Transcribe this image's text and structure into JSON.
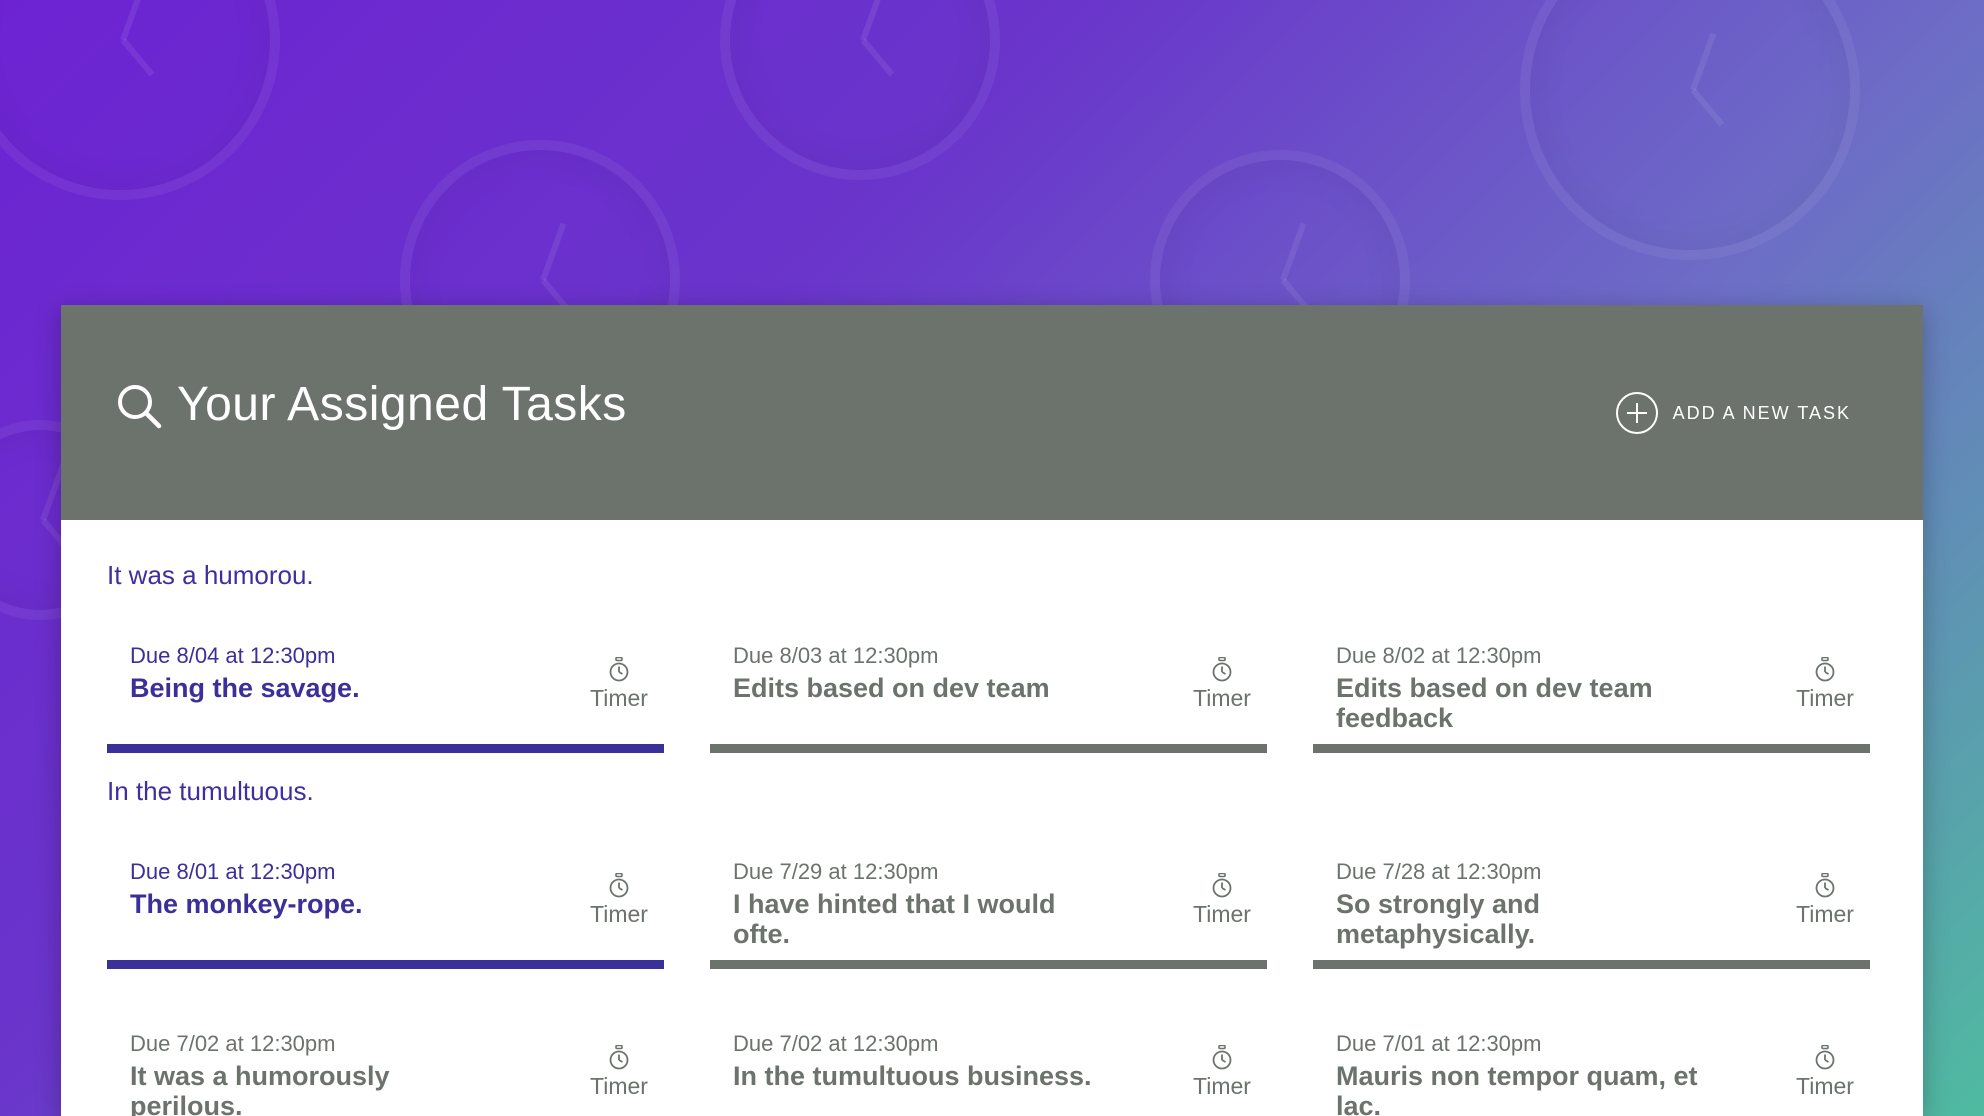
{
  "header": {
    "title": "Your Assigned Tasks",
    "add_task_label": "ADD A NEW TASK"
  },
  "sections": [
    {
      "title": "It was a humorou."
    },
    {
      "title": "In the tumultuous."
    }
  ],
  "rows": [
    {
      "cards": [
        {
          "due": "Due 8/04 at 12:30pm",
          "title": "Being the savage.",
          "timer_label": "Timer",
          "active": true
        },
        {
          "due": "Due 8/03 at 12:30pm",
          "title": "Edits based on dev team",
          "timer_label": "Timer",
          "active": false
        },
        {
          "due": "Due 8/02 at 12:30pm",
          "title": "Edits based on dev team feedback",
          "timer_label": "Timer",
          "active": false
        }
      ]
    },
    {
      "cards": [
        {
          "due": "Due 8/01 at 12:30pm",
          "title": "The monkey-rope.",
          "timer_label": "Timer",
          "active": true
        },
        {
          "due": "Due 7/29 at 12:30pm",
          "title": "I have hinted that I would ofte.",
          "timer_label": "Timer",
          "active": false
        },
        {
          "due": "Due 7/28 at 12:30pm",
          "title": "So strongly and metaphysically.",
          "timer_label": "Timer",
          "active": false
        }
      ]
    },
    {
      "cards": [
        {
          "due": "Due 7/02 at 12:30pm",
          "title": "It was a humorously perilous.",
          "timer_label": "Timer",
          "active": false
        },
        {
          "due": "Due 7/02 at 12:30pm",
          "title": "In the tumultuous business.",
          "timer_label": "Timer",
          "active": false
        },
        {
          "due": "Due 7/01 at 12:30pm",
          "title": "Mauris non tempor quam, et lac.",
          "timer_label": "Timer",
          "active": false
        }
      ]
    }
  ],
  "colors": {
    "header_bg": "#6c736d",
    "accent": "#3b2f9a",
    "muted": "#6c736d"
  },
  "icons": {
    "search": "search-icon",
    "add": "plus-circle-icon",
    "timer": "stopwatch-icon"
  }
}
